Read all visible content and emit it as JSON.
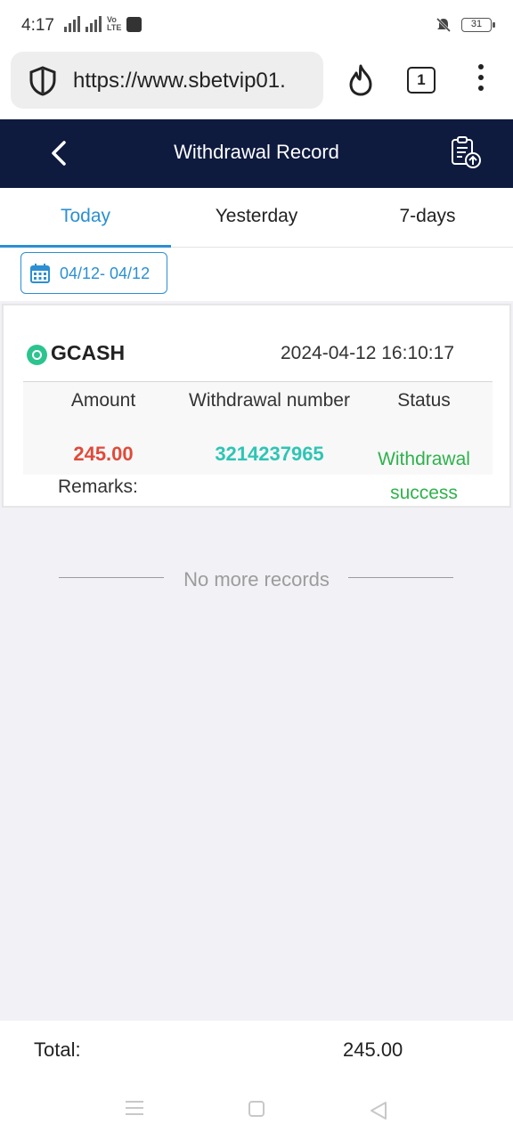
{
  "status_bar": {
    "time": "4:17",
    "network_label": "4G",
    "lte_label": "Vo LTE",
    "battery": "31"
  },
  "browser": {
    "url": "https://www.sbetvip01.",
    "tab_count": "1"
  },
  "header": {
    "title": "Withdrawal Record"
  },
  "tabs": [
    {
      "label": "Today",
      "active": true
    },
    {
      "label": "Yesterday",
      "active": false
    },
    {
      "label": "7-days",
      "active": false
    }
  ],
  "date_filter": {
    "range": "04/12- 04/12"
  },
  "record": {
    "method": "GCASH",
    "datetime": "2024-04-12 16:10:17",
    "headers": {
      "amount": "Amount",
      "number": "Withdrawal number",
      "status": "Status"
    },
    "amount": "245.00",
    "withdrawal_number": "3214237965",
    "status": "Withdrawal success",
    "remarks_label": "Remarks:"
  },
  "no_more": "No more records",
  "total": {
    "label": "Total:",
    "value": "245.00"
  },
  "colors": {
    "header_bg": "#0e1a3e",
    "accent_blue": "#2b8fd2",
    "amount_red": "#e04a3a",
    "number_teal": "#2ec5b4",
    "status_green": "#2fb24c",
    "gcash_green": "#2bc48e"
  }
}
